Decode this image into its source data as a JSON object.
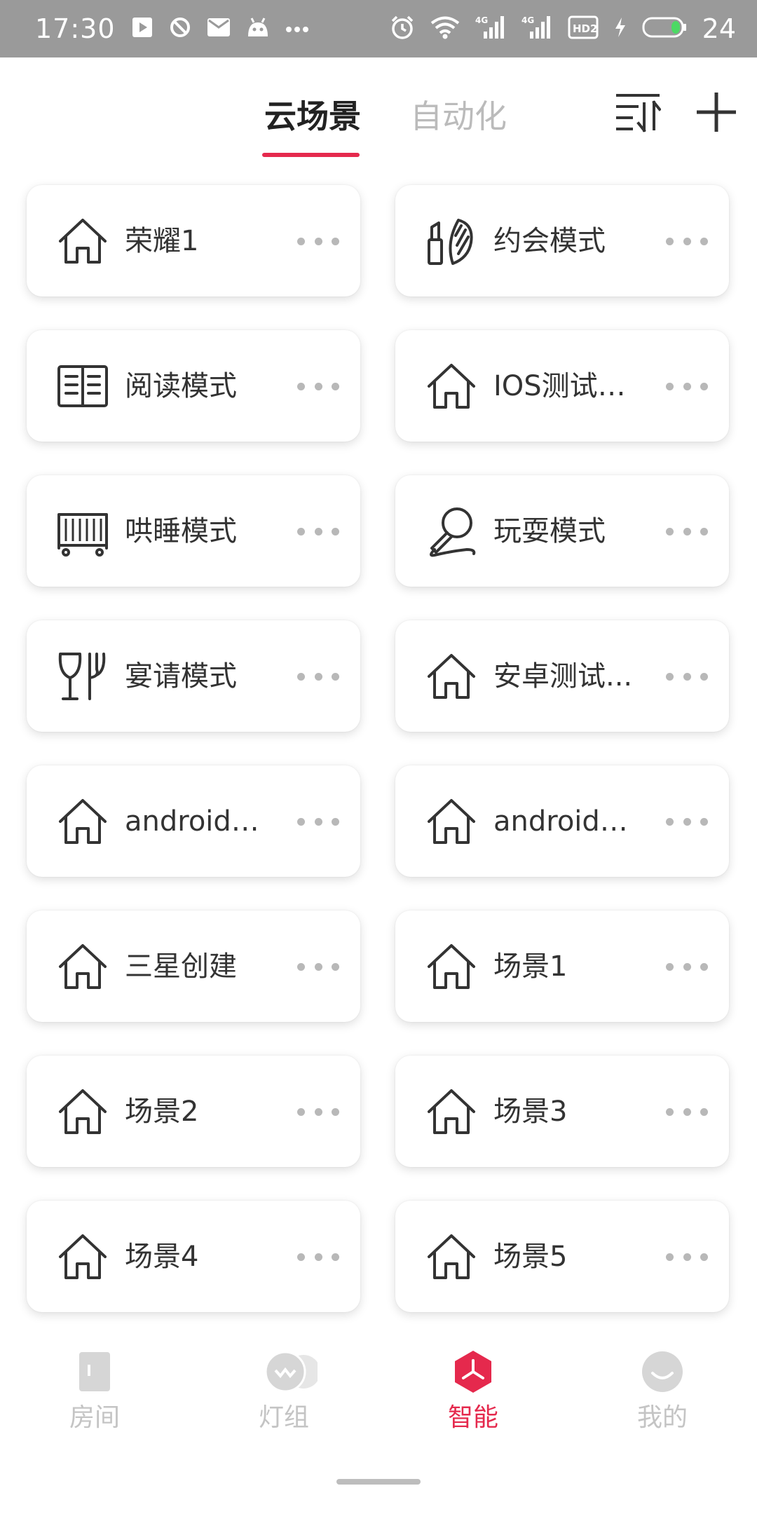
{
  "status_bar": {
    "time": "17:30",
    "battery": "24",
    "left_icons": [
      "play-icon",
      "block-icon",
      "mail-icon",
      "android-icon",
      "more-icon"
    ],
    "right_icons": [
      "alarm-icon",
      "wifi-icon",
      "signal-4g-icon",
      "signal-4g-icon",
      "hd-icon",
      "charging-icon",
      "battery-icon"
    ],
    "network_label": "4G",
    "hd_label": "HD2"
  },
  "header": {
    "tabs": [
      {
        "label": "云场景",
        "active": true
      },
      {
        "label": "自动化",
        "active": false
      }
    ],
    "accent_color": "#e5294d",
    "sort_icon": "sort-icon",
    "add_icon": "plus-icon"
  },
  "scenes": [
    {
      "label": "荣耀1",
      "icon": "house-icon"
    },
    {
      "label": "约会模式",
      "icon": "lipstick-icon"
    },
    {
      "label": "阅读模式",
      "icon": "book-icon"
    },
    {
      "label": "IOS测试预...",
      "icon": "house-icon"
    },
    {
      "label": "哄睡模式",
      "icon": "crib-icon"
    },
    {
      "label": "玩耍模式",
      "icon": "microphone-icon"
    },
    {
      "label": "宴请模式",
      "icon": "dining-icon"
    },
    {
      "label": "安卓测试...",
      "icon": "house-icon"
    },
    {
      "label": "android测...",
      "icon": "house-icon"
    },
    {
      "label": "android开...",
      "icon": "house-icon"
    },
    {
      "label": "三星创建",
      "icon": "house-icon"
    },
    {
      "label": "场景1",
      "icon": "house-icon"
    },
    {
      "label": "场景2",
      "icon": "house-icon"
    },
    {
      "label": "场景3",
      "icon": "house-icon"
    },
    {
      "label": "场景4",
      "icon": "house-icon"
    },
    {
      "label": "场景5",
      "icon": "house-icon"
    }
  ],
  "bottom_nav": [
    {
      "label": "房间",
      "icon": "room-icon",
      "active": false
    },
    {
      "label": "灯组",
      "icon": "light-group-icon",
      "active": false
    },
    {
      "label": "智能",
      "icon": "smart-icon",
      "active": true
    },
    {
      "label": "我的",
      "icon": "profile-icon",
      "active": false
    }
  ]
}
